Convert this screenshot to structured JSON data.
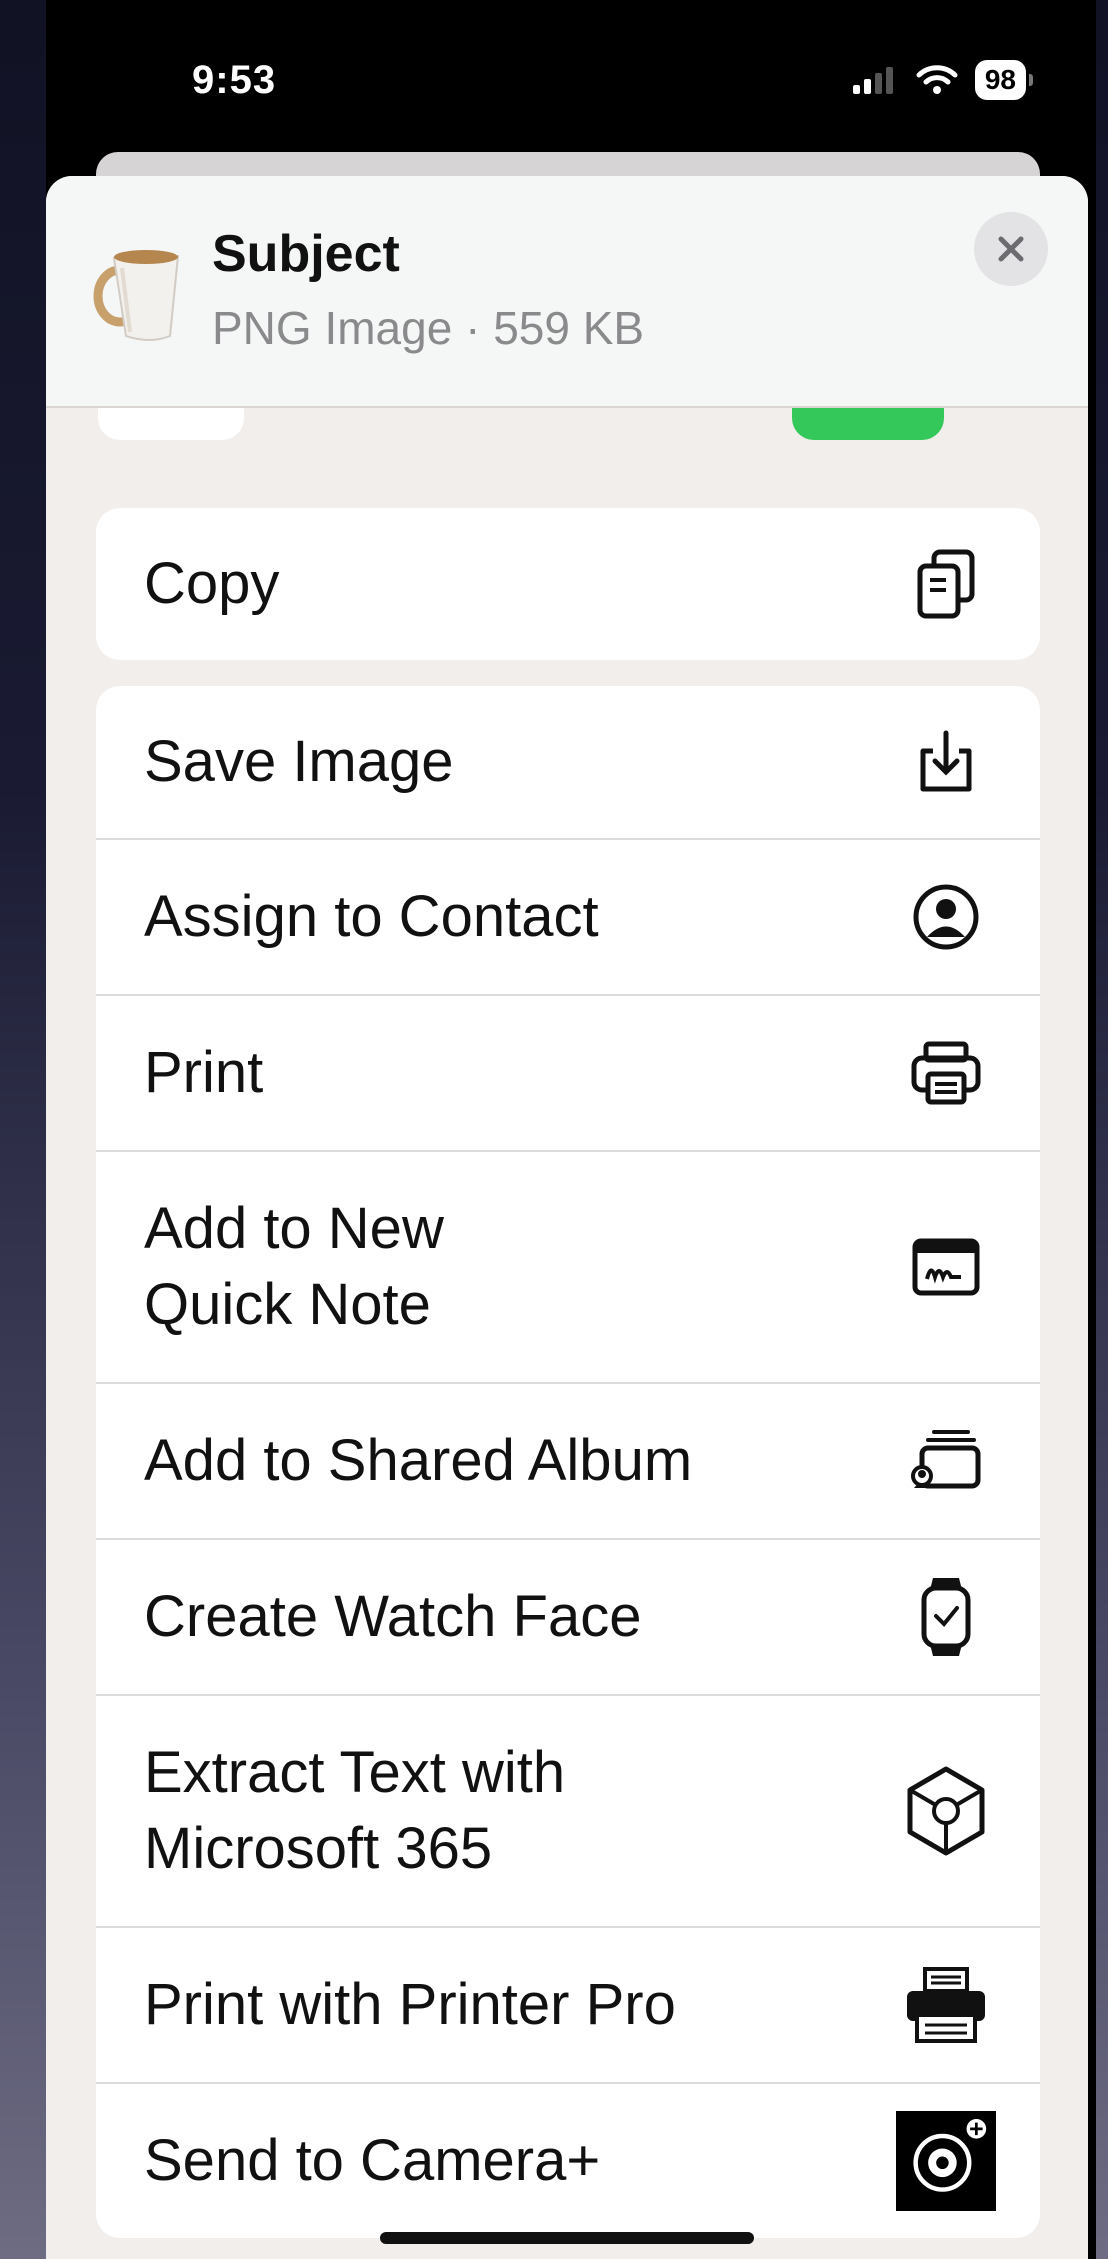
{
  "status_bar": {
    "time": "9:53",
    "battery": "98"
  },
  "header": {
    "title": "Subject",
    "subtitle": "PNG Image · 559 KB"
  },
  "actions_primary": [
    {
      "label": "Copy",
      "icon": "copy-icon"
    }
  ],
  "actions": [
    {
      "label": "Save Image",
      "icon": "save-image-icon"
    },
    {
      "label": "Assign to Contact",
      "icon": "contact-icon"
    },
    {
      "label": "Print",
      "icon": "printer-icon"
    },
    {
      "label": "Add to New\nQuick Note",
      "icon": "quick-note-icon"
    },
    {
      "label": "Add to Shared Album",
      "icon": "shared-album-icon"
    },
    {
      "label": "Create Watch Face",
      "icon": "watch-icon"
    },
    {
      "label": "Extract Text with\nMicrosoft 365",
      "icon": "microsoft-365-icon"
    },
    {
      "label": "Print with Printer Pro",
      "icon": "printer-pro-icon"
    },
    {
      "label": "Send to Camera+",
      "icon": "camera-plus-icon"
    }
  ],
  "colors": {
    "accent_green": "#34c759",
    "sheet_bg": "#f2eeeb"
  }
}
